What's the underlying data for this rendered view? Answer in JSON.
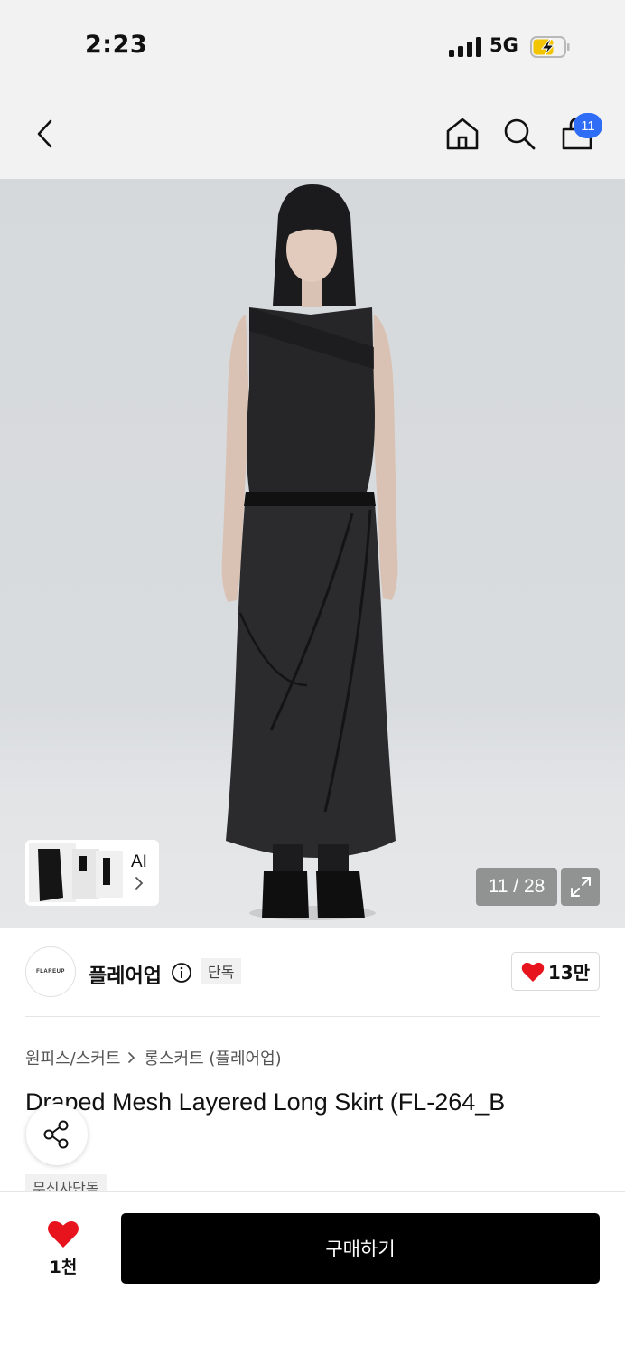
{
  "status_bar": {
    "time": "2:23",
    "network": "5G",
    "battery_charging": true
  },
  "nav": {
    "cart_count": "11",
    "icons": [
      "back-icon",
      "home-icon",
      "search-icon",
      "cart-icon"
    ]
  },
  "gallery": {
    "counter": "11 / 28",
    "ai_label": "AI"
  },
  "brand": {
    "logo_text": "FLAREUP",
    "name": "플레어업",
    "exclusive_tag": "단독",
    "likes": "13만"
  },
  "breadcrumb": {
    "category": "원피스/스커트",
    "subcategory": "롱스커트 (플레어업)"
  },
  "product": {
    "title": "Draped Mesh Layered Long Skirt (FL-264_B",
    "tag": "무신사단독"
  },
  "bottom_bar": {
    "wish_count": "1천",
    "buy_label": "구매하기"
  },
  "colors": {
    "accent_blue": "#2f6df6",
    "heart_red": "#e8141d",
    "buy_bg": "#000000"
  }
}
